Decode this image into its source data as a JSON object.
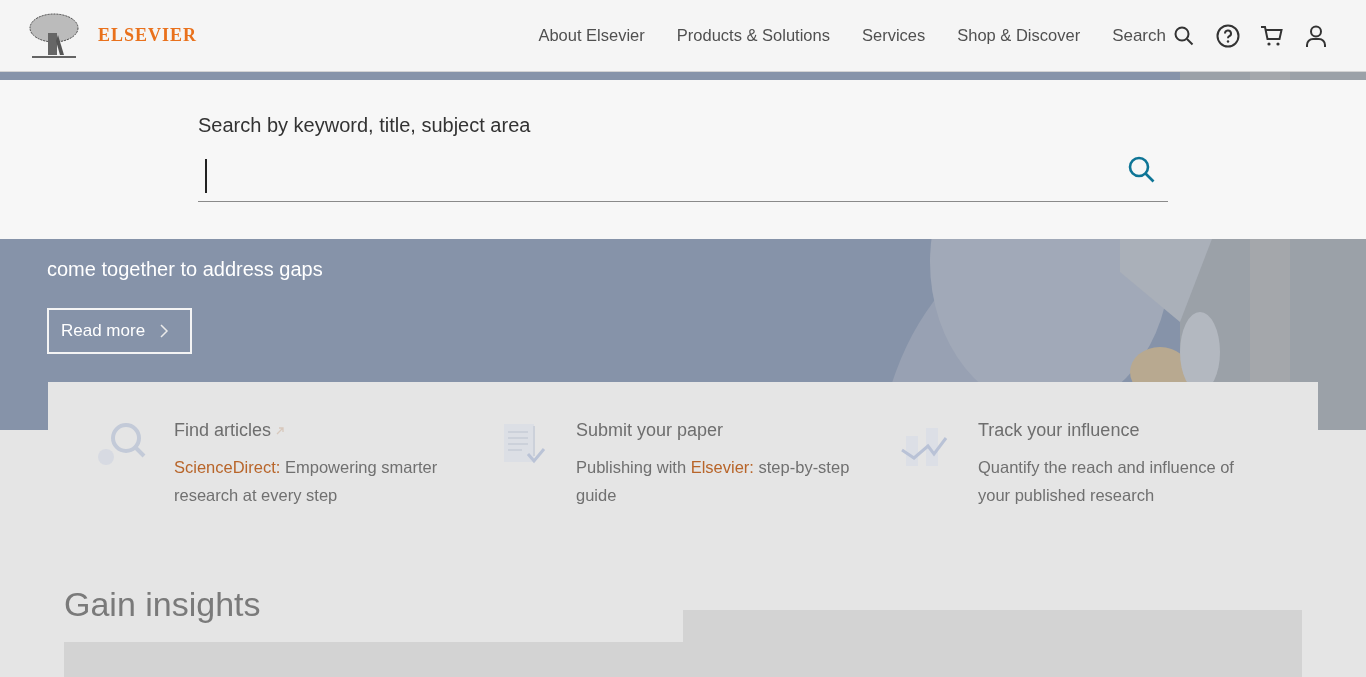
{
  "header": {
    "brand": "ELSEVIER",
    "nav": [
      {
        "label": "About Elsevier"
      },
      {
        "label": "Products & Solutions"
      },
      {
        "label": "Services"
      },
      {
        "label": "Shop & Discover"
      }
    ],
    "search_label": "Search"
  },
  "search_panel": {
    "label": "Search by keyword, title, subject area"
  },
  "hero": {
    "kind": "picture",
    "lines": [
      "come together to address gaps"
    ],
    "button": "Read more"
  },
  "cards": [
    {
      "title": "Find articles",
      "external": true,
      "description": [
        {
          "text": "ScienceDirect:",
          "kind": "link"
        },
        {
          "text": " Empowering smarter research at every step",
          "kind": "plain"
        }
      ]
    },
    {
      "title": "Submit your paper",
      "external": false,
      "description": [
        {
          "text": "Publishing with ",
          "kind": "plain"
        },
        {
          "text": "Elsevier:",
          "kind": "link"
        },
        {
          "text": " step-by-step guide",
          "kind": "plain"
        }
      ]
    },
    {
      "title": "Track your influence",
      "external": false,
      "description": [
        {
          "text": "Quantify the reach and influence of your published research",
          "kind": "plain"
        }
      ]
    }
  ],
  "insights": {
    "heading": "Gain insights"
  }
}
